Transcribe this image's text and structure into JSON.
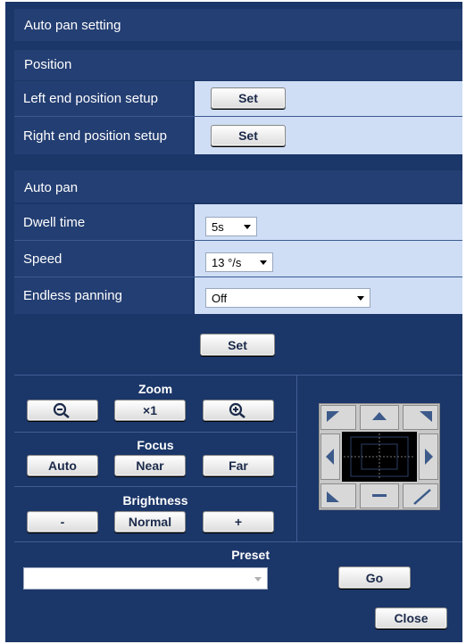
{
  "header": {
    "title": "Auto pan setting"
  },
  "position_section": {
    "title": "Position",
    "left_end": {
      "label": "Left end position setup",
      "button": "Set"
    },
    "right_end": {
      "label": "Right end position setup",
      "button": "Set"
    }
  },
  "autopan_section": {
    "title": "Auto pan",
    "dwell_time": {
      "label": "Dwell time",
      "value": "5s"
    },
    "speed": {
      "label": "Speed",
      "value": "13 °/s"
    },
    "endless_panning": {
      "label": "Endless panning",
      "value": "Off"
    },
    "set_button": "Set"
  },
  "camera_control": {
    "zoom": {
      "label": "Zoom",
      "out_icon": "zoom-out-icon",
      "reset": "×1",
      "in_icon": "zoom-in-icon"
    },
    "focus": {
      "label": "Focus",
      "auto": "Auto",
      "near": "Near",
      "far": "Far"
    },
    "brightness": {
      "label": "Brightness",
      "minus": "-",
      "normal": "Normal",
      "plus": "+"
    }
  },
  "preset": {
    "label": "Preset",
    "value": "",
    "go_button": "Go"
  },
  "footer": {
    "close_button": "Close"
  },
  "colors": {
    "panel": "#1b3668",
    "value_cell": "#cfdef5",
    "label_cell": "#233e72"
  }
}
